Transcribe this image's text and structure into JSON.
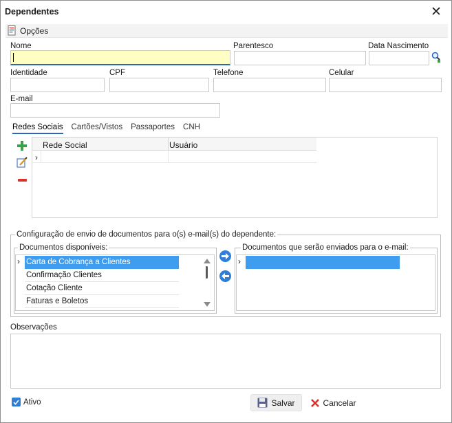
{
  "window": {
    "title": "Dependentes",
    "close_glyph": "✕"
  },
  "toolbar": {
    "options_label": "Opções",
    "options_icon": "document-options-icon"
  },
  "fields": {
    "nome": {
      "label": "Nome",
      "value": ""
    },
    "parentesco": {
      "label": "Parentesco",
      "value": ""
    },
    "data_nascimento": {
      "label": "Data Nascimento",
      "value": ""
    },
    "identidade": {
      "label": "Identidade",
      "value": ""
    },
    "cpf": {
      "label": "CPF",
      "value": ""
    },
    "telefone": {
      "label": "Telefone",
      "value": ""
    },
    "celular": {
      "label": "Celular",
      "value": ""
    },
    "email": {
      "label": "E-mail",
      "value": ""
    }
  },
  "tabs": [
    {
      "label": "Redes Sociais",
      "active": true
    },
    {
      "label": "Cartões/Vistos",
      "active": false
    },
    {
      "label": "Passaportes",
      "active": false
    },
    {
      "label": "CNH",
      "active": false
    }
  ],
  "social_grid": {
    "columns": [
      "Rede Social",
      "Usuário"
    ],
    "rows": [
      [
        "",
        ""
      ]
    ],
    "row_pointer": "›",
    "actions": {
      "add_icon": "plus-icon",
      "edit_icon": "edit-icon",
      "remove_icon": "minus-icon"
    }
  },
  "email_config": {
    "legend": "Configuração de envio de documentos para o(s) e-mail(s) do dependente:",
    "available": {
      "legend": "Documentos disponíveis:",
      "items": [
        "Carta de Cobrança a Clientes",
        "Confirmação Clientes",
        "Cotação Cliente",
        "Faturas e Boletos"
      ],
      "selected_index": 0,
      "row_pointer": "›"
    },
    "to_send": {
      "legend": "Documentos que serão enviados para o e-mail:",
      "items": [
        ""
      ],
      "row_pointer": "›"
    },
    "move_right_icon": "arrow-right-icon",
    "move_left_icon": "arrow-left-icon"
  },
  "observacoes": {
    "label": "Observações",
    "value": ""
  },
  "ativo": {
    "label": "Ativo",
    "checked": true
  },
  "buttons": {
    "save": "Salvar",
    "cancel": "Cancelar"
  },
  "colors": {
    "accent": "#2b63c6",
    "selection": "#3f9df0",
    "focused_field": "#ffffc4"
  }
}
